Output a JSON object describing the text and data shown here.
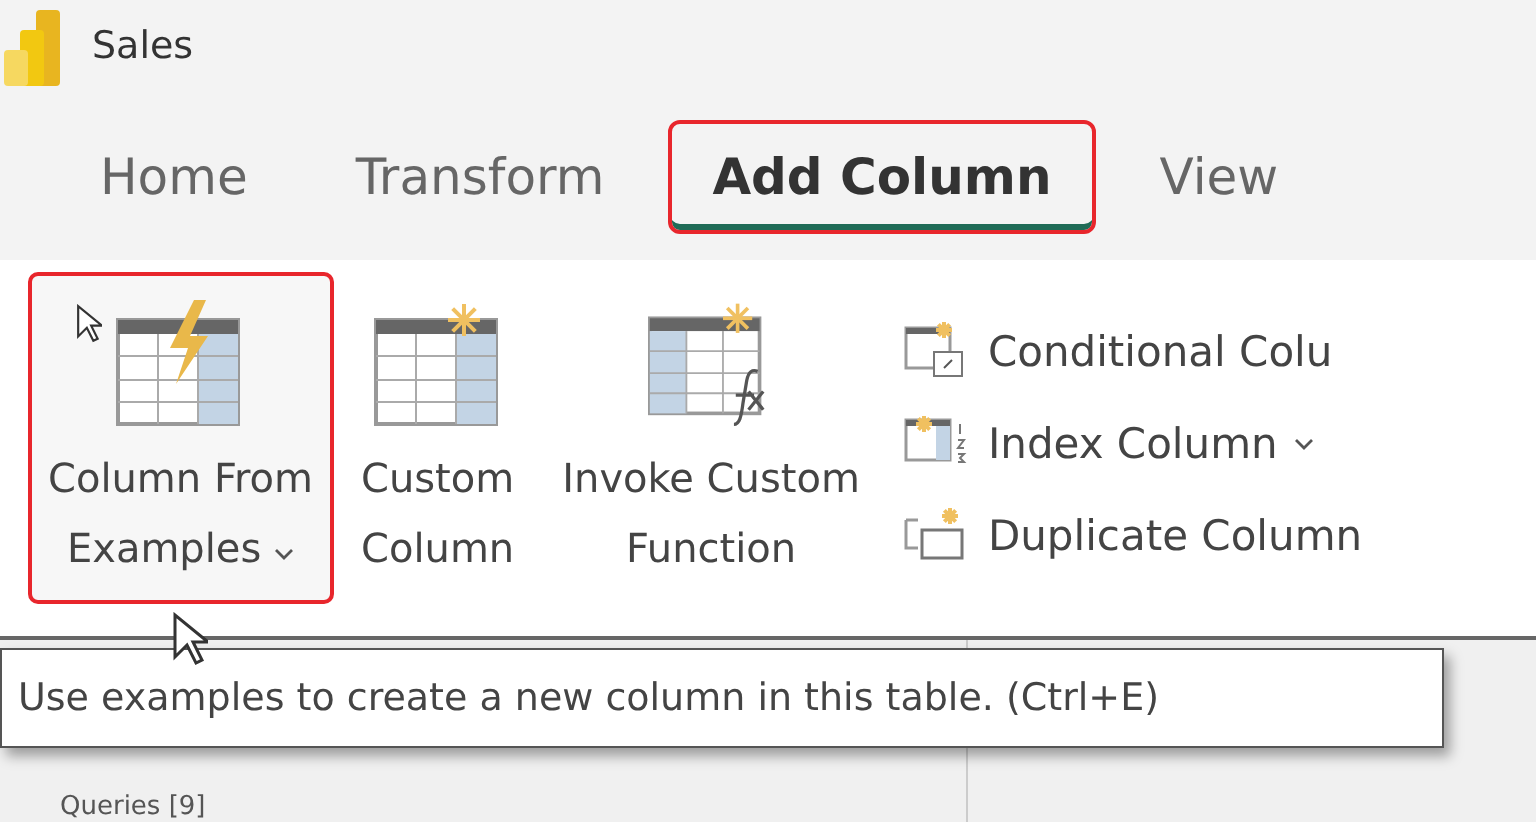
{
  "window": {
    "title": "Sales"
  },
  "tabs": [
    {
      "label": "Home",
      "selected": false,
      "highlighted": false
    },
    {
      "label": "Transform",
      "selected": false,
      "highlighted": false
    },
    {
      "label": "Add Column",
      "selected": true,
      "highlighted": true
    },
    {
      "label": "View",
      "selected": false,
      "highlighted": false
    }
  ],
  "large_buttons": [
    {
      "kind": "examples",
      "lines": [
        "Column From",
        "Examples"
      ],
      "dropdown": true,
      "highlighted": true
    },
    {
      "kind": "custom",
      "lines": [
        "Custom",
        "Column"
      ],
      "dropdown": false,
      "highlighted": false
    },
    {
      "kind": "invoke",
      "lines": [
        "Invoke Custom",
        "Function"
      ],
      "dropdown": false,
      "highlighted": false
    }
  ],
  "small_buttons": [
    {
      "kind": "conditional",
      "label": "Conditional Colu",
      "dropdown": false
    },
    {
      "kind": "index",
      "label": "Index Column",
      "dropdown": true
    },
    {
      "kind": "duplicate",
      "label": "Duplicate Column",
      "dropdown": false
    }
  ],
  "tooltip": "Use examples to create a new column in this table. (Ctrl+E)",
  "queries_pane": {
    "title": "Queries [9]"
  }
}
